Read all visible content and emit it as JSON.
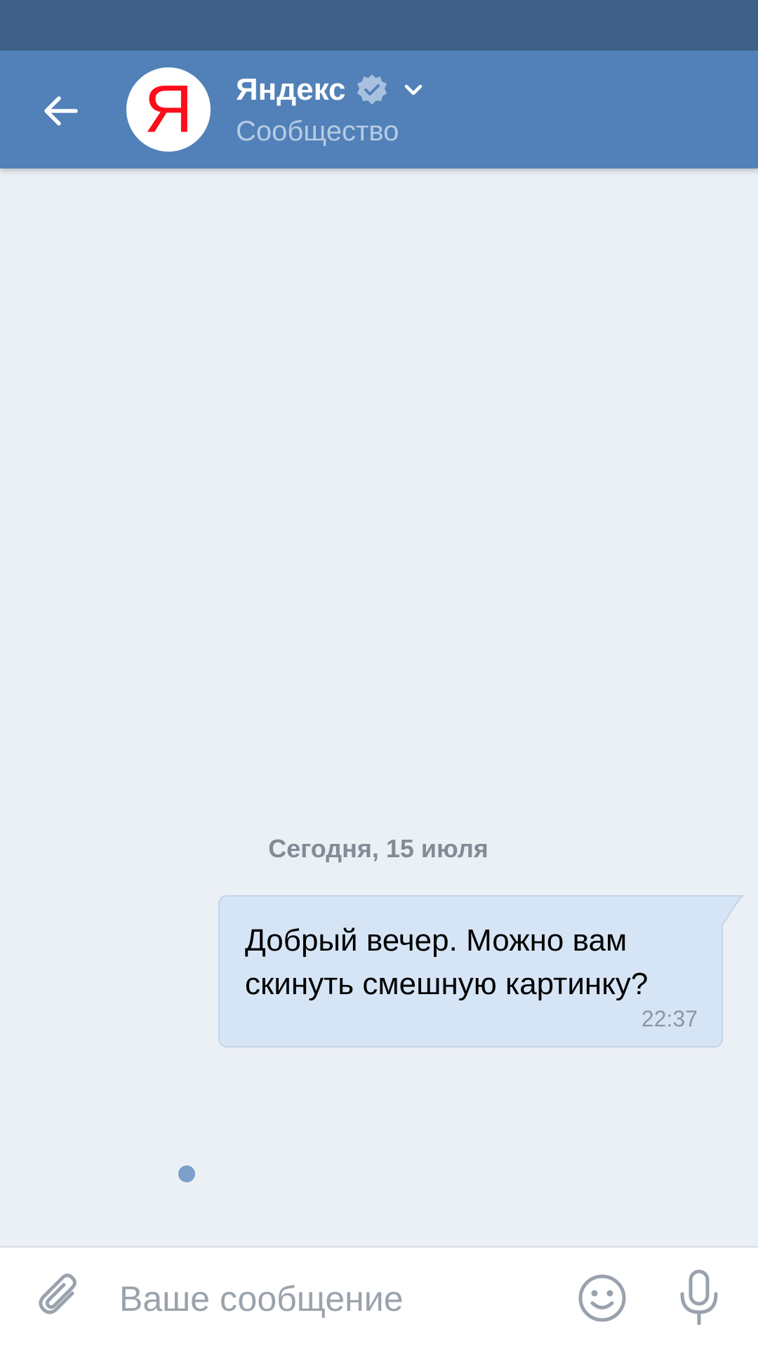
{
  "header": {
    "title": "Яндекс",
    "subtitle": "Сообщество",
    "avatar_letter": "Я",
    "back_icon": "arrow-left-icon",
    "verified_icon": "verified-badge-icon",
    "dropdown_icon": "chevron-down-icon"
  },
  "chat": {
    "date_separator": "Сегодня, 15 июля",
    "messages": [
      {
        "text": "Добрый вечер. Можно вам скинуть смешную картинку?",
        "time": "22:37",
        "outgoing": true,
        "unread": true
      }
    ]
  },
  "composer": {
    "placeholder": "Ваше сообщение",
    "value": "",
    "attach_icon": "paperclip-icon",
    "emoji_icon": "smiley-icon",
    "mic_icon": "microphone-icon"
  },
  "colors": {
    "status_bar": "#3f6188",
    "header": "#5181b8",
    "background": "#ebf0f5",
    "bubble": "#d6e5f6",
    "logo_red": "#fc0d1b"
  }
}
